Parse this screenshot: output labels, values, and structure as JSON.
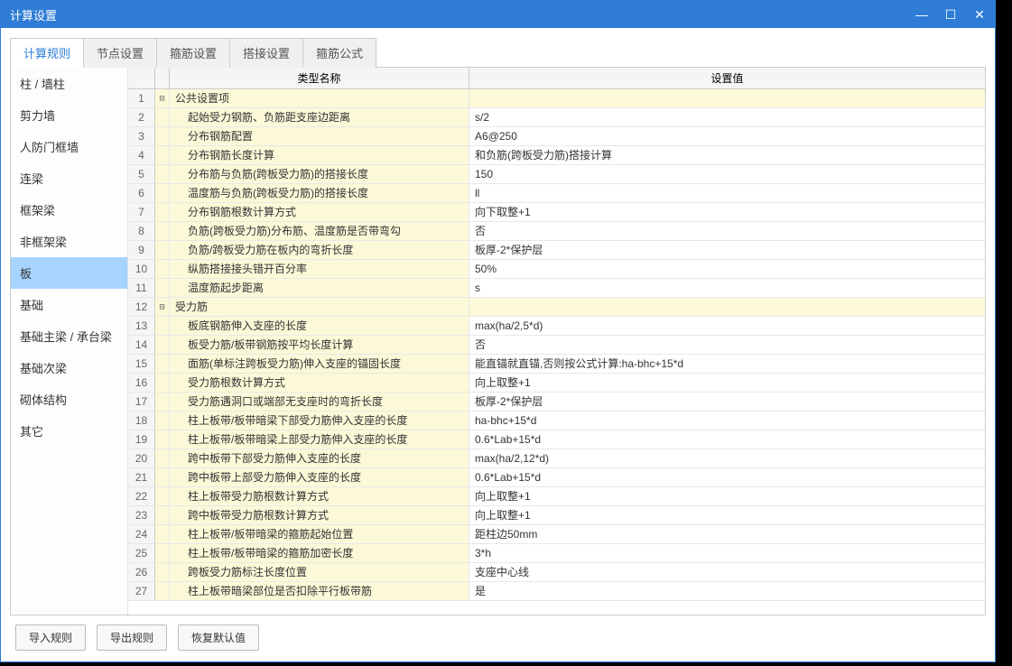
{
  "window": {
    "title": "计算设置"
  },
  "tabs": [
    {
      "label": "计算规则",
      "active": true
    },
    {
      "label": "节点设置",
      "active": false
    },
    {
      "label": "箍筋设置",
      "active": false
    },
    {
      "label": "搭接设置",
      "active": false
    },
    {
      "label": "箍筋公式",
      "active": false
    }
  ],
  "sidebar": {
    "items": [
      "柱 / 墙柱",
      "剪力墙",
      "人防门框墙",
      "连梁",
      "框架梁",
      "非框架梁",
      "板",
      "基础",
      "基础主梁 / 承台梁",
      "基础次梁",
      "砌体结构",
      "其它"
    ],
    "active_index": 6
  },
  "grid": {
    "headers": {
      "name": "类型名称",
      "value": "设置值"
    },
    "rows": [
      {
        "n": 1,
        "type": "group",
        "tree": "-",
        "name": "公共设置项",
        "value": ""
      },
      {
        "n": 2,
        "type": "child",
        "tree": "",
        "name": "起始受力钢筋、负筋距支座边距离",
        "value": "s/2"
      },
      {
        "n": 3,
        "type": "child",
        "tree": "",
        "name": "分布钢筋配置",
        "value": "A6@250"
      },
      {
        "n": 4,
        "type": "child",
        "tree": "",
        "name": "分布钢筋长度计算",
        "value": "和负筋(跨板受力筋)搭接计算"
      },
      {
        "n": 5,
        "type": "child",
        "tree": "",
        "name": "分布筋与负筋(跨板受力筋)的搭接长度",
        "value": "150"
      },
      {
        "n": 6,
        "type": "child",
        "tree": "",
        "name": "温度筋与负筋(跨板受力筋)的搭接长度",
        "value": "ll"
      },
      {
        "n": 7,
        "type": "child",
        "tree": "",
        "name": "分布钢筋根数计算方式",
        "value": "向下取整+1"
      },
      {
        "n": 8,
        "type": "child",
        "tree": "",
        "name": "负筋(跨板受力筋)分布筋、温度筋是否带弯勾",
        "value": "否"
      },
      {
        "n": 9,
        "type": "child",
        "tree": "",
        "name": "负筋/跨板受力筋在板内的弯折长度",
        "value": "板厚-2*保护层"
      },
      {
        "n": 10,
        "type": "child",
        "tree": "",
        "name": "纵筋搭接接头错开百分率",
        "value": "50%"
      },
      {
        "n": 11,
        "type": "child",
        "tree": "",
        "name": "温度筋起步距离",
        "value": "s"
      },
      {
        "n": 12,
        "type": "group",
        "tree": "-",
        "name": "受力筋",
        "value": ""
      },
      {
        "n": 13,
        "type": "child",
        "tree": "",
        "name": "板底钢筋伸入支座的长度",
        "value": "max(ha/2,5*d)"
      },
      {
        "n": 14,
        "type": "child",
        "tree": "",
        "name": "板受力筋/板带钢筋按平均长度计算",
        "value": "否"
      },
      {
        "n": 15,
        "type": "child",
        "tree": "",
        "name": "面筋(单标注跨板受力筋)伸入支座的锚固长度",
        "value": "能直锚就直锚,否则按公式计算:ha-bhc+15*d"
      },
      {
        "n": 16,
        "type": "child",
        "tree": "",
        "name": "受力筋根数计算方式",
        "value": "向上取整+1"
      },
      {
        "n": 17,
        "type": "child",
        "tree": "",
        "name": "受力筋遇洞口或端部无支座时的弯折长度",
        "value": "板厚-2*保护层"
      },
      {
        "n": 18,
        "type": "child",
        "tree": "",
        "name": "柱上板带/板带暗梁下部受力筋伸入支座的长度",
        "value": "ha-bhc+15*d"
      },
      {
        "n": 19,
        "type": "child",
        "tree": "",
        "name": "柱上板带/板带暗梁上部受力筋伸入支座的长度",
        "value": "0.6*Lab+15*d"
      },
      {
        "n": 20,
        "type": "child",
        "tree": "",
        "name": "跨中板带下部受力筋伸入支座的长度",
        "value": "max(ha/2,12*d)"
      },
      {
        "n": 21,
        "type": "child",
        "tree": "",
        "name": "跨中板带上部受力筋伸入支座的长度",
        "value": "0.6*Lab+15*d"
      },
      {
        "n": 22,
        "type": "child",
        "tree": "",
        "name": "柱上板带受力筋根数计算方式",
        "value": "向上取整+1"
      },
      {
        "n": 23,
        "type": "child",
        "tree": "",
        "name": "跨中板带受力筋根数计算方式",
        "value": "向上取整+1"
      },
      {
        "n": 24,
        "type": "child",
        "tree": "",
        "name": "柱上板带/板带暗梁的箍筋起始位置",
        "value": "距柱边50mm"
      },
      {
        "n": 25,
        "type": "child",
        "tree": "",
        "name": "柱上板带/板带暗梁的箍筋加密长度",
        "value": "3*h"
      },
      {
        "n": 26,
        "type": "child",
        "tree": "",
        "name": "跨板受力筋标注长度位置",
        "value": "支座中心线"
      },
      {
        "n": 27,
        "type": "child",
        "tree": "",
        "name": "柱上板带暗梁部位是否扣除平行板带筋",
        "value": "是"
      }
    ]
  },
  "footer": {
    "import_label": "导入规则",
    "export_label": "导出规则",
    "restore_label": "恢复默认值"
  }
}
